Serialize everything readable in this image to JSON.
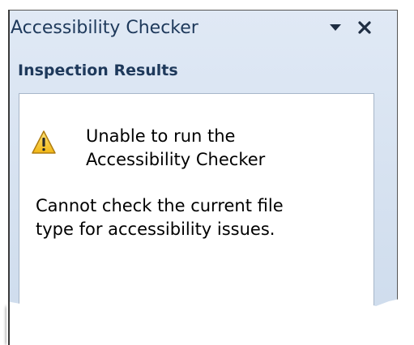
{
  "pane": {
    "title": "Accessibility Checker",
    "dropdown_icon": "chevron-down-icon",
    "close_icon": "close-icon"
  },
  "results": {
    "heading": "Inspection Results",
    "icon": "warning-icon",
    "message_title_line1": "Unable to run the",
    "message_title_line2": "Accessibility Checker",
    "message_body_line1": "Cannot check the current file",
    "message_body_line2": "type for accessibility issues."
  },
  "colors": {
    "title_text": "#1e395b",
    "pane_gradient_top": "#dbe6f4",
    "pane_gradient_bottom": "#cbdaed",
    "box_border": "#a7b6c9",
    "warning_fill": "#f5c518"
  }
}
